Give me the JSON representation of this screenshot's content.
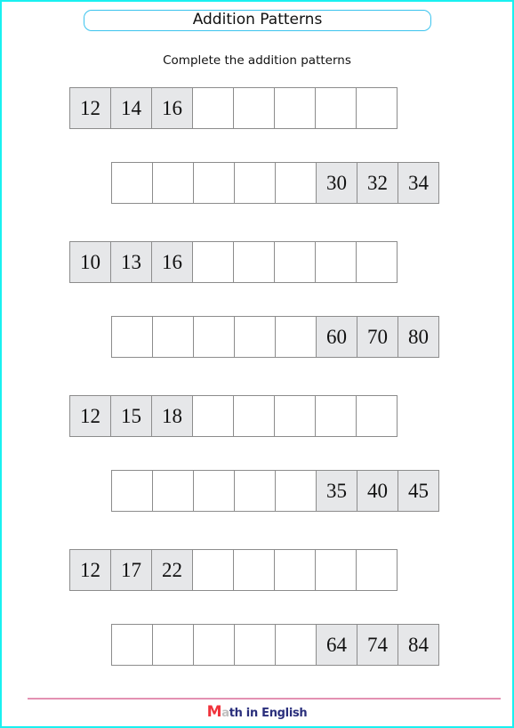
{
  "header": {
    "title": "Addition Patterns",
    "instructions": "Complete the addition patterns"
  },
  "patterns": [
    {
      "cells": [
        "12",
        "14",
        "16",
        "",
        "",
        "",
        "",
        ""
      ],
      "given": [
        true,
        true,
        true,
        false,
        false,
        false,
        false,
        false
      ],
      "indent": false
    },
    {
      "cells": [
        "",
        "",
        "",
        "",
        "",
        "30",
        "32",
        "34"
      ],
      "given": [
        false,
        false,
        false,
        false,
        false,
        true,
        true,
        true
      ],
      "indent": true
    },
    {
      "cells": [
        "10",
        "13",
        "16",
        "",
        "",
        "",
        "",
        ""
      ],
      "given": [
        true,
        true,
        true,
        false,
        false,
        false,
        false,
        false
      ],
      "indent": false
    },
    {
      "cells": [
        "",
        "",
        "",
        "",
        "",
        "60",
        "70",
        "80"
      ],
      "given": [
        false,
        false,
        false,
        false,
        false,
        true,
        true,
        true
      ],
      "indent": true
    },
    {
      "cells": [
        "12",
        "15",
        "18",
        "",
        "",
        "",
        "",
        ""
      ],
      "given": [
        true,
        true,
        true,
        false,
        false,
        false,
        false,
        false
      ],
      "indent": false
    },
    {
      "cells": [
        "",
        "",
        "",
        "",
        "",
        "35",
        "40",
        "45"
      ],
      "given": [
        false,
        false,
        false,
        false,
        false,
        true,
        true,
        true
      ],
      "indent": true
    },
    {
      "cells": [
        "12",
        "17",
        "22",
        "",
        "",
        "",
        "",
        ""
      ],
      "given": [
        true,
        true,
        true,
        false,
        false,
        false,
        false,
        false
      ],
      "indent": false
    },
    {
      "cells": [
        "",
        "",
        "",
        "",
        "",
        "64",
        "74",
        "84"
      ],
      "given": [
        false,
        false,
        false,
        false,
        false,
        true,
        true,
        true
      ],
      "indent": true
    }
  ],
  "footer": {
    "logo_first_letter": "M",
    "logo_second_letter": "a",
    "logo_rest": "th in English"
  },
  "colors": {
    "frame": "#19f0f0",
    "title_border": "#3cc4ee",
    "given_cell": "#e6e7e9",
    "footer_rule": "#e391b2",
    "logo_m": "#f0333c",
    "logo_text": "#2a2f7c"
  }
}
